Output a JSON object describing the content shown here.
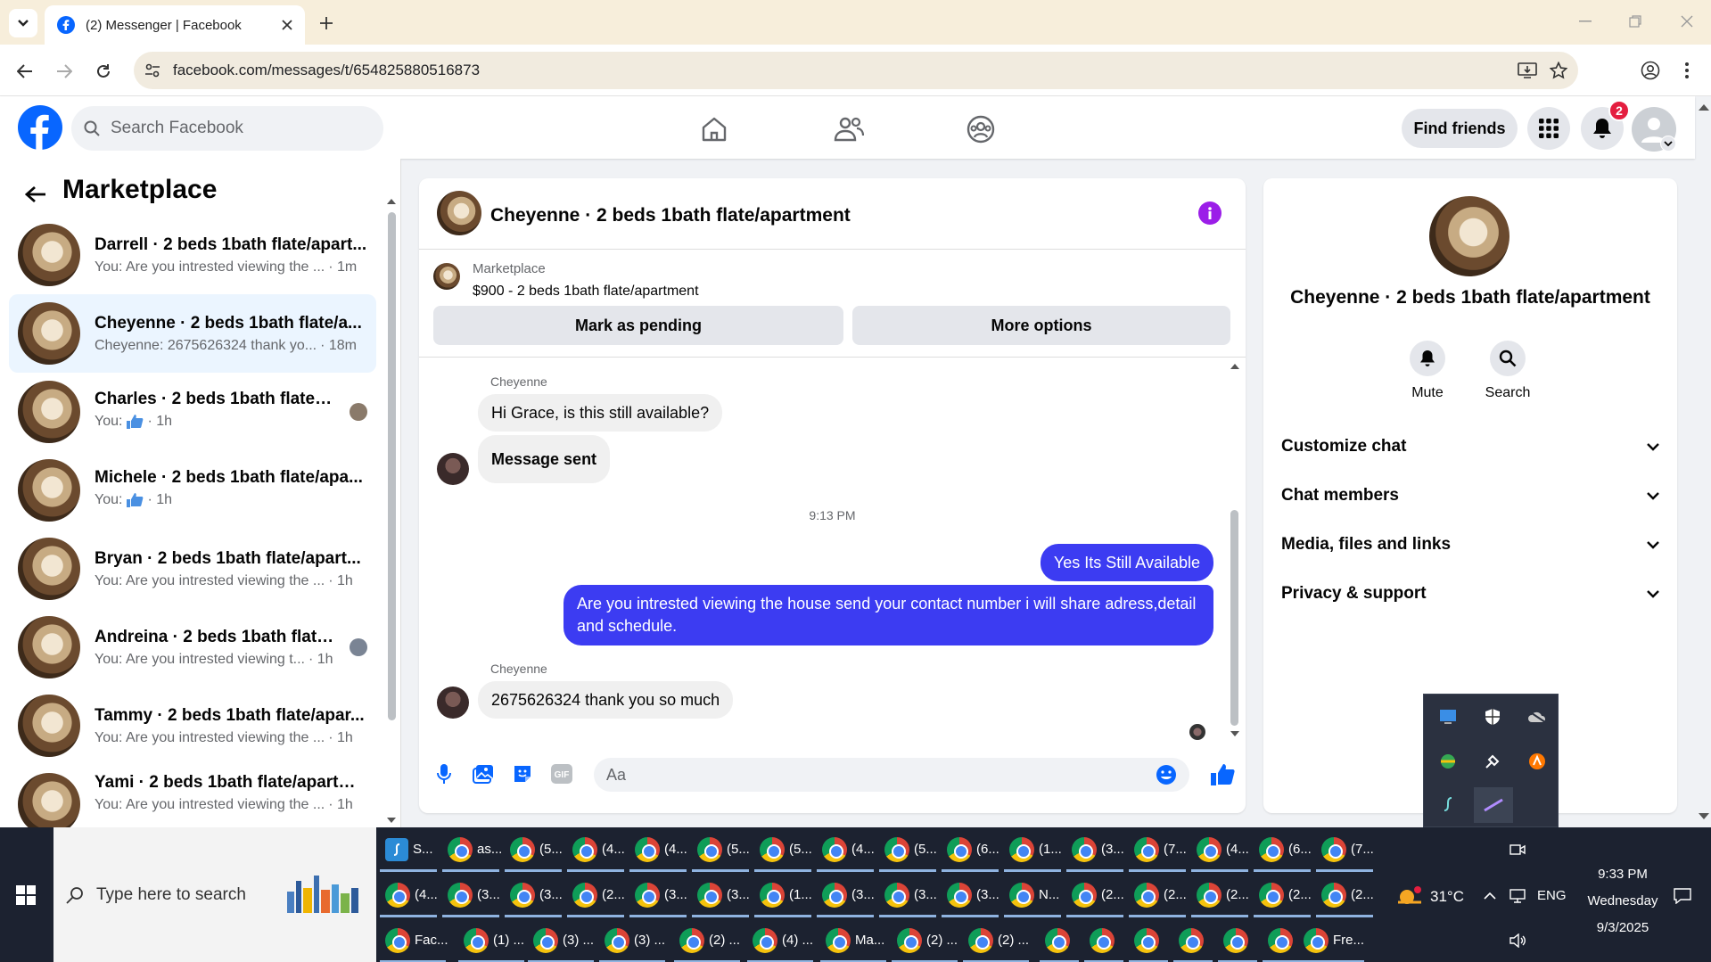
{
  "browser": {
    "tab_title": "(2) Messenger | Facebook",
    "url": "facebook.com/messages/t/654825880516873"
  },
  "fb": {
    "search_placeholder": "Search Facebook",
    "find_friends": "Find friends",
    "notif_count": "2"
  },
  "left": {
    "title": "Marketplace",
    "conversations": [
      {
        "name": "Darrell · 2 beds 1bath flate/apart...",
        "preview": "You: Are you intrested viewing the ...",
        "time": "· 1m"
      },
      {
        "name": "Cheyenne · 2 beds 1bath flate/a...",
        "preview": "Cheyenne: 2675626324 thank yo...",
        "time": "· 18m"
      },
      {
        "name": "Charles · 2 beds 1bath flate/a...",
        "preview": "You:",
        "time": "· 1h"
      },
      {
        "name": "Michele · 2 beds 1bath flate/apa...",
        "preview": "You:",
        "time": "· 1h"
      },
      {
        "name": "Bryan · 2 beds 1bath flate/apart...",
        "preview": "You: Are you intrested viewing the ...",
        "time": "· 1h"
      },
      {
        "name": "Andreina · 2 beds 1bath flate/...",
        "preview": "You: Are you intrested viewing t...",
        "time": "· 1h"
      },
      {
        "name": "Tammy · 2 beds 1bath flate/apar...",
        "preview": "You: Are you intrested viewing the ...",
        "time": "· 1h"
      },
      {
        "name": "Yami · 2 beds 1bath flate/apartm...",
        "preview": "You: Are you intrested viewing the ...",
        "time": "· 1h"
      }
    ]
  },
  "chat": {
    "title": "Cheyenne · 2 beds 1bath flate/apartment",
    "listing_source": "Marketplace",
    "listing_detail": "$900 - 2 beds 1bath flate/apartment",
    "mark_pending": "Mark as pending",
    "more_options": "More options",
    "messages": {
      "sender1": "Cheyenne",
      "m1": "Hi Grace, is this still available?",
      "m2": "Message sent",
      "timestamp": "9:13 PM",
      "m3": "Yes Its Still Available",
      "m4": "Are you intrested viewing the house send your contact number i will share adress,detail and schedule.",
      "sender2": "Cheyenne",
      "m5": "2675626324 thank you so much"
    },
    "composer_placeholder": "Aa"
  },
  "right": {
    "title": "Cheyenne · 2 beds 1bath flate/apartment",
    "mute": "Mute",
    "search": "Search",
    "sections": [
      "Customize chat",
      "Chat members",
      "Media, files and links",
      "Privacy & support"
    ]
  },
  "taskbar": {
    "search_placeholder": "Type here to search",
    "temp": "31°C",
    "lang": "ENG",
    "time": "9:33 PM",
    "day": "Wednesday",
    "date": "9/3/2025",
    "row1": [
      "S...",
      "as...",
      "(5...",
      "(4...",
      "(4...",
      "(5...",
      "(5...",
      "(4...",
      "(5...",
      "(6...",
      "(1...",
      "(3...",
      "(7...",
      "(4...",
      "(6...",
      "(7..."
    ],
    "row2": [
      "(4...",
      "(3...",
      "(3...",
      "(2...",
      "(3...",
      "(3...",
      "(1...",
      "(3...",
      "(3...",
      "(3...",
      "N...",
      "(2...",
      "(2...",
      "(2...",
      "(2...",
      "(2..."
    ],
    "row3": [
      "Fac...",
      "(1) ...",
      "(3) ...",
      "(3) ...",
      "(2) ...",
      "(4) ...",
      "Ma...",
      "(2) ...",
      "(2) ...",
      "",
      "",
      "",
      "",
      "",
      "",
      "Fre..."
    ]
  },
  "colors": {
    "fb_blue": "#0866ff",
    "out_bubble": "#3c3cf2",
    "taskbar": "#1c2230",
    "tabstrip": "#f7eedb"
  }
}
